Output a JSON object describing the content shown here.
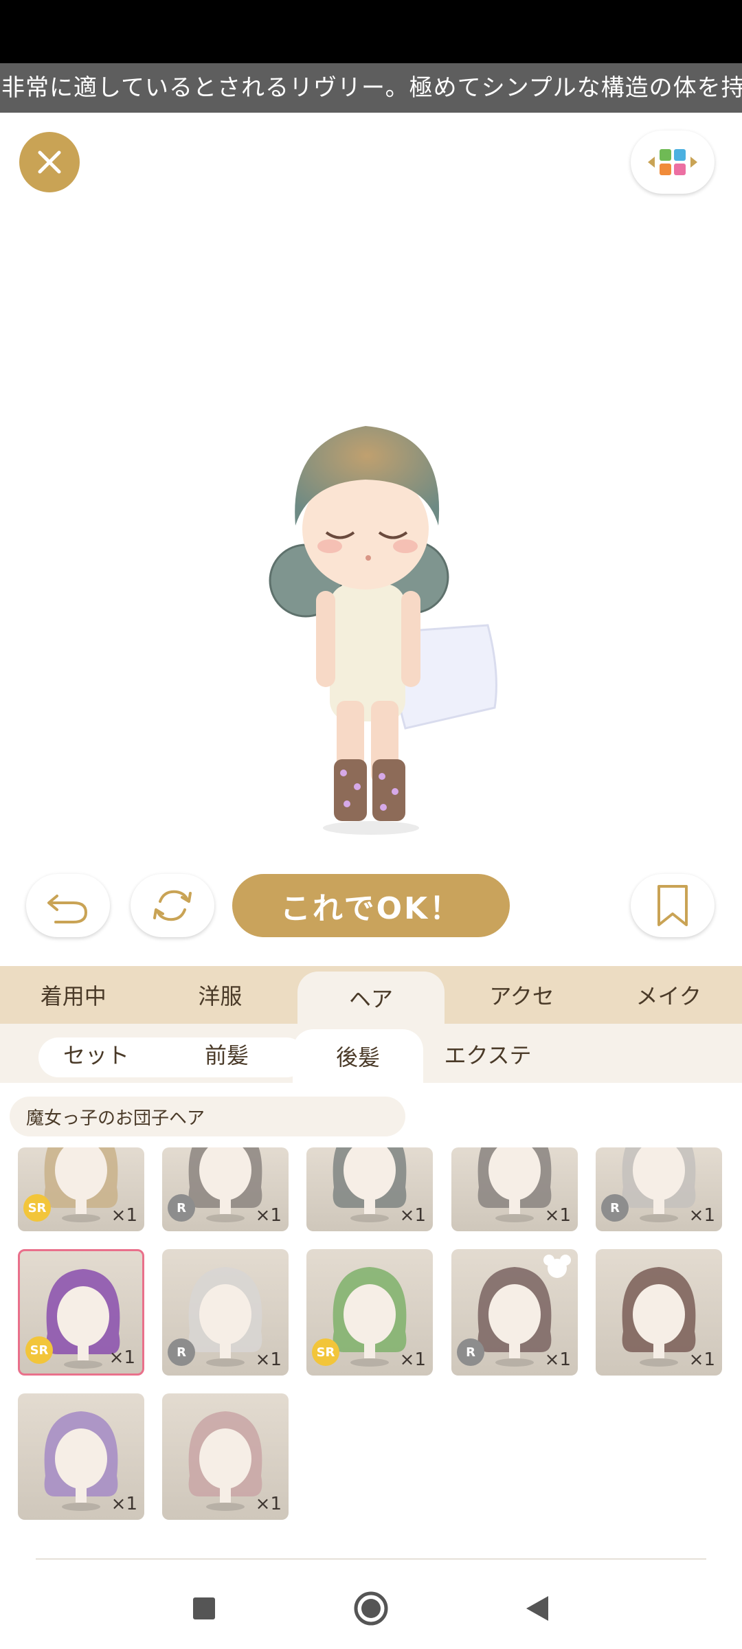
{
  "ticker_text": "非常に適しているとされるリヴリー。極めてシンプルな構造の体を持ち",
  "buttons": {
    "close": "close",
    "ok_label": "これでOK！"
  },
  "category_tabs": [
    {
      "label": "着用中",
      "active": false
    },
    {
      "label": "洋服",
      "active": false
    },
    {
      "label": "ヘア",
      "active": true
    },
    {
      "label": "アクセ",
      "active": false
    },
    {
      "label": "メイク",
      "active": false
    }
  ],
  "sub_tabs": [
    {
      "label": "セット",
      "active": false
    },
    {
      "label": "前髪",
      "active": false
    },
    {
      "label": "後髪",
      "active": true
    },
    {
      "label": "エクステ",
      "active": false
    }
  ],
  "selected_item_name": "魔女っ子のお団子ヘア",
  "items": [
    {
      "rarity": "SR",
      "qty": "×1",
      "hair": "#c9b18a",
      "selected": false,
      "bear": false
    },
    {
      "rarity": "R",
      "qty": "×1",
      "hair": "#8c8580",
      "selected": false,
      "bear": false
    },
    {
      "rarity": "",
      "qty": "×1",
      "hair": "#7f8582",
      "selected": false,
      "bear": false
    },
    {
      "rarity": "",
      "qty": "×1",
      "hair": "#8a8480",
      "selected": false,
      "bear": false
    },
    {
      "rarity": "R",
      "qty": "×1",
      "hair": "#c4c1bd",
      "selected": false,
      "bear": false
    },
    {
      "rarity": "SR",
      "qty": "×1",
      "hair": "#8a4fae",
      "selected": true,
      "bear": false
    },
    {
      "rarity": "R",
      "qty": "×1",
      "hair": "#d8d6d3",
      "selected": false,
      "bear": false
    },
    {
      "rarity": "SR",
      "qty": "×1",
      "hair": "#7fb16b",
      "selected": false,
      "bear": false
    },
    {
      "rarity": "R",
      "qty": "×1",
      "hair": "#7a6461",
      "selected": false,
      "bear": true
    },
    {
      "rarity": "",
      "qty": "×1",
      "hair": "#7a5e57",
      "selected": false,
      "bear": false
    },
    {
      "rarity": "",
      "qty": "×1",
      "hair": "#a58bc6",
      "selected": false,
      "bear": false
    },
    {
      "rarity": "",
      "qty": "×1",
      "hair": "#c9a6a6",
      "selected": false,
      "bear": false
    }
  ],
  "colors": {
    "accent_gold": "#c9a355",
    "tab_bg": "#ecdcc2",
    "selected_border": "#e9708b",
    "sr_badge": "#f2c53a",
    "r_badge": "#8d8d8d"
  },
  "icons": {
    "close": "close-icon",
    "grid": "grid-toggle-icon",
    "undo": "undo-icon",
    "refresh": "refresh-icon",
    "bookmark": "bookmark-icon",
    "nav_recents": "square-icon",
    "nav_home": "circle-icon",
    "nav_back": "triangle-back-icon"
  }
}
